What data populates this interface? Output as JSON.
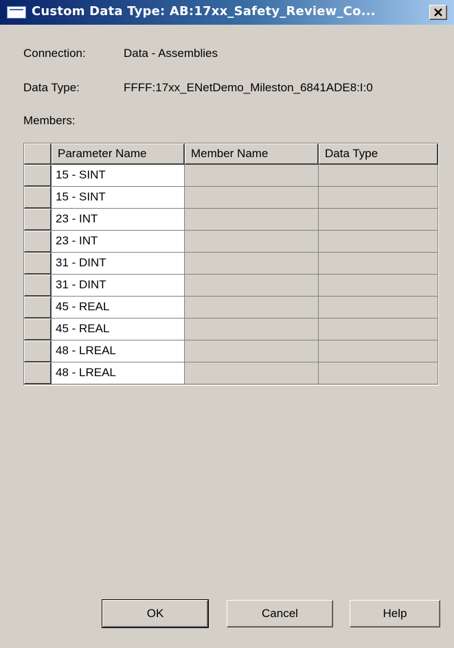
{
  "window": {
    "title": "Custom Data Type:  AB:17xx_Safety_Review_Co...",
    "close_icon": "close-icon"
  },
  "fields": {
    "connection_label": "Connection:",
    "connection_value": "Data - Assemblies",
    "datatype_label": "Data Type:",
    "datatype_value": "FFFF:17xx_ENetDemo_Mileston_6841ADE8:I:0",
    "members_label": "Members:"
  },
  "grid": {
    "columns": [
      "Parameter Name",
      "Member Name",
      "Data Type"
    ],
    "rows": [
      {
        "parameter": "15 - SINT",
        "member": "",
        "data_type": ""
      },
      {
        "parameter": "15 - SINT",
        "member": "",
        "data_type": ""
      },
      {
        "parameter": "23 - INT",
        "member": "",
        "data_type": ""
      },
      {
        "parameter": "23 - INT",
        "member": "",
        "data_type": ""
      },
      {
        "parameter": "31 - DINT",
        "member": "",
        "data_type": ""
      },
      {
        "parameter": "31 - DINT",
        "member": "",
        "data_type": ""
      },
      {
        "parameter": "45 - REAL",
        "member": "",
        "data_type": ""
      },
      {
        "parameter": "45 - REAL",
        "member": "",
        "data_type": ""
      },
      {
        "parameter": "48 - LREAL",
        "member": "",
        "data_type": ""
      },
      {
        "parameter": "48 - LREAL",
        "member": "",
        "data_type": ""
      }
    ]
  },
  "buttons": {
    "ok": "OK",
    "cancel": "Cancel",
    "help": "Help"
  },
  "colors": {
    "dialog_bg": "#d4d0c8",
    "titlebar_start": "#0a246a",
    "titlebar_end": "#a6caf0",
    "editable_cell": "#ffffff"
  }
}
